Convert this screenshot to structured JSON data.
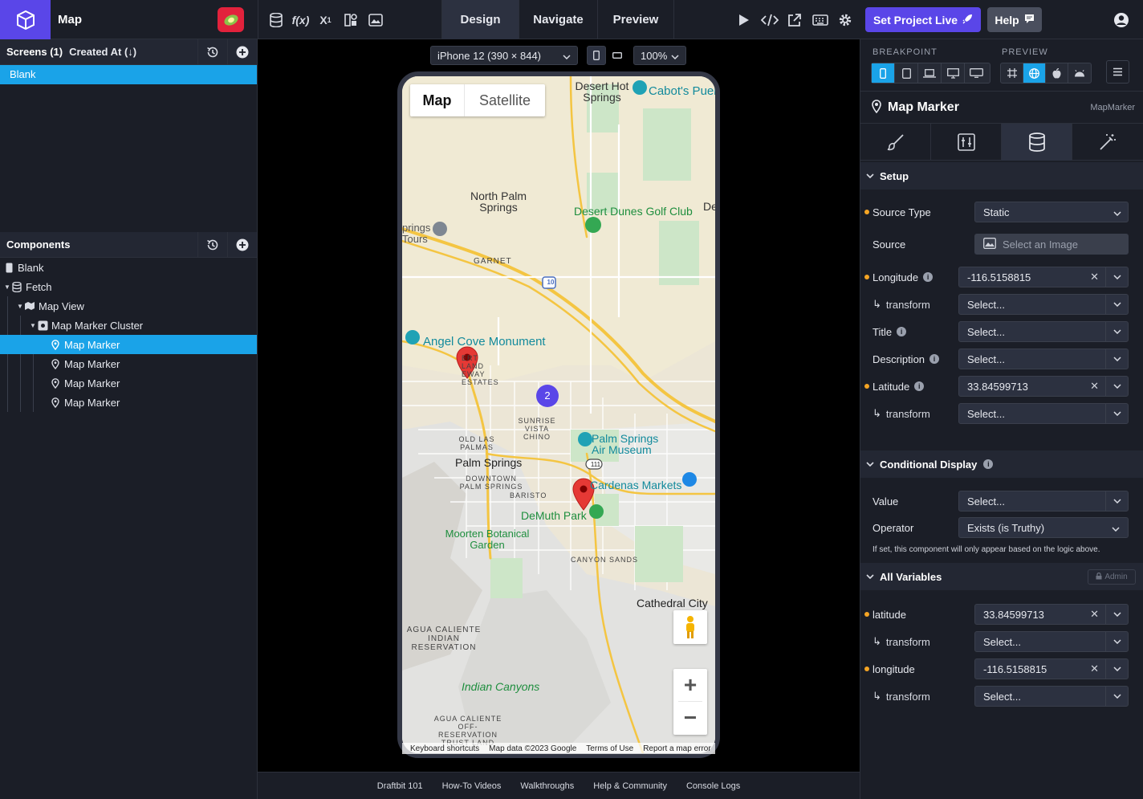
{
  "app": {
    "title": "Map"
  },
  "top_tabs": {
    "design": "Design",
    "navigate": "Navigate",
    "preview": "Preview"
  },
  "toolbar_icons": [
    "database-icon",
    "function-icon",
    "subscript-icon",
    "assets-icon",
    "images-icon"
  ],
  "right_tools": [
    "play-icon",
    "code-icon",
    "share-icon",
    "keyboard-icon",
    "gear-icon"
  ],
  "buttons": {
    "set_live": "Set Project Live",
    "help": "Help"
  },
  "left": {
    "screens_title": "Screens (1)",
    "screens_sort": "Created At (↓)",
    "screens": [
      {
        "label": "Blank"
      }
    ],
    "components_title": "Components",
    "tree": [
      {
        "label": "Blank",
        "icon": "phone-icon",
        "depth": 0
      },
      {
        "label": "Fetch",
        "icon": "database-icon",
        "depth": 0
      },
      {
        "label": "Map View",
        "icon": "map-icon",
        "depth": 1
      },
      {
        "label": "Map Marker Cluster",
        "icon": "cluster-icon",
        "depth": 2
      },
      {
        "label": "Map Marker",
        "icon": "pin-icon",
        "depth": 3,
        "selected": true
      },
      {
        "label": "Map Marker",
        "icon": "pin-icon",
        "depth": 3
      },
      {
        "label": "Map Marker",
        "icon": "pin-icon",
        "depth": 3
      },
      {
        "label": "Map Marker",
        "icon": "pin-icon",
        "depth": 3
      }
    ]
  },
  "canvas": {
    "device": "iPhone 12 (390 × 844)",
    "zoom": "100%",
    "map_type": {
      "map": "Map",
      "satellite": "Satellite"
    },
    "places": {
      "desert_hot_springs": "Desert Hot Springs",
      "cabots": "Cabot's Puebl",
      "north_palm_springs": "North Palm Springs",
      "desert_dunes": "Desert Dunes Golf Club",
      "de": "De",
      "springs_tours": "prings Tours",
      "garnet": "GARNET",
      "angel_cove": "Angel Cove Monument",
      "desert_highland": "ERT LAND EWAY ESTATES",
      "sunrise_vista": "SUNRISE VISTA CHINO",
      "old_las_palmas": "OLD LAS PALMAS",
      "palm_springs": "Palm Springs",
      "air_museum": "Palm Springs Air Museum",
      "downtown": "DOWNTOWN PALM SPRINGS",
      "baristo": "BARISTO",
      "cardenas": "Cardenas Markets",
      "demuth": "DeMuth Park",
      "moorten": "Moorten Botanical Garden",
      "canyon_sands": "CANYON SANDS",
      "cathedral_city": "Cathedral City",
      "agua_caliente": "AGUA CALIENTE INDIAN RESERVATION",
      "indian_canyons": "Indian Canyons",
      "agua_off": "AGUA CALIENTE OFF-RESERVATION TRUST LAND",
      "route_10": "10",
      "route_111": "111",
      "cluster_count": "2"
    },
    "map_footer": [
      "Keyboard shortcuts",
      "Map data ©2023 Google",
      "Terms of Use",
      "Report a map error"
    ],
    "colors": {
      "marker": "#e53935",
      "cluster": "#5a46e8",
      "highway": "#f4c542"
    }
  },
  "footer_links": [
    "Draftbit 101",
    "How-To Videos",
    "Walkthroughs",
    "Help & Community",
    "Console Logs"
  ],
  "right": {
    "breakpoint_label": "BREAKPOINT",
    "preview_label": "PREVIEW",
    "component_name": "Map Marker",
    "component_type": "MapMarker",
    "setup_title": "Setup",
    "rows": {
      "source_type": {
        "label": "Source Type",
        "value": "Static"
      },
      "source": {
        "label": "Source",
        "placeholder": "Select an Image"
      },
      "longitude": {
        "label": "Longitude",
        "value": "-116.5158815"
      },
      "longitude_transform": {
        "label": "transform",
        "value": "Select..."
      },
      "title": {
        "label": "Title",
        "value": "Select..."
      },
      "description": {
        "label": "Description",
        "value": "Select..."
      },
      "latitude": {
        "label": "Latitude",
        "value": "33.84599713"
      },
      "latitude_transform": {
        "label": "transform",
        "value": "Select..."
      }
    },
    "conditional_title": "Conditional Display",
    "conditional": {
      "value": {
        "label": "Value",
        "value": "Select..."
      },
      "operator": {
        "label": "Operator",
        "value": "Exists (is Truthy)"
      },
      "hint": "If set, this component will only appear based on the logic above."
    },
    "variables_title": "All Variables",
    "admin_badge": "Admin",
    "variables": {
      "latitude": {
        "label": "latitude",
        "value": "33.84599713"
      },
      "latitude_transform": {
        "label": "transform",
        "value": "Select..."
      },
      "longitude": {
        "label": "longitude",
        "value": "-116.5158815"
      },
      "longitude_transform": {
        "label": "transform",
        "value": "Select..."
      }
    }
  },
  "accent": "#5a46e8",
  "selection": "#1aa3e8"
}
